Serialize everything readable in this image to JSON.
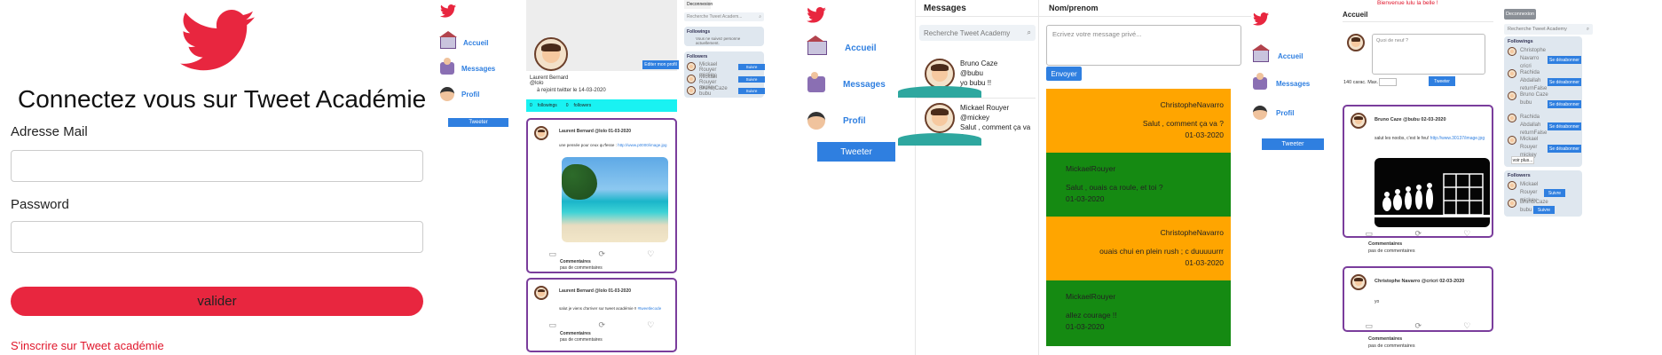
{
  "login": {
    "title": "Connectez vous sur Tweet Académie",
    "email_label": "Adresse Mail",
    "password_label": "Password",
    "submit_label": "valider",
    "signup_link": "S'inscrire sur Tweet académie",
    "brand_color": "#e8263f"
  },
  "profile_page": {
    "nav": {
      "home": "Accueil",
      "messages": "Messages",
      "profile": "Profil",
      "tweet_button": "Tweeter"
    },
    "user_name": "Laurent Bernard",
    "user_handle": "@lolo",
    "joined": "à rejoint twitter le 14-03-2020",
    "edit_button": "Editer mon profil",
    "followings_label": "followings",
    "followers_label": "followers",
    "followings_count": "0",
    "followers_count": "0",
    "logout_button": "Deconnexion",
    "search_placeholder": "Recherche Tweet Academ...",
    "followings_box": {
      "title": "Followings",
      "empty": "Vous ne suivez personne actuellement."
    },
    "followers_box": {
      "title": "Followers",
      "users": [
        {
          "name": "Mickael Rouyer",
          "handle": "mickey",
          "button": "Suivre"
        },
        {
          "name": "Mickael Rouyer",
          "handle": "mickey",
          "button": "Suivre"
        },
        {
          "name": "Bruno Caze",
          "handle": "bubu",
          "button": "Suivre"
        }
      ]
    },
    "tweets": [
      {
        "header": "Laurent Bernard @lolo 01-03-2020",
        "text": "une pensée pour ceux qu'fesse :",
        "link": "http://www.p0000/image.jpg",
        "comments_label": "Commentaires",
        "comments": "pas de commentaires"
      },
      {
        "header": "Laurent Bernard @lolo 01-03-2020",
        "text": "salut je viens d'arriver sur tweet académie !!",
        "link": "#tweetlecode",
        "comments_label": "Commentaires",
        "comments": "pas de commentaires"
      }
    ]
  },
  "messages_page": {
    "nav": {
      "home": "Accueil",
      "messages": "Messages",
      "profile": "Profil",
      "tweet_button": "Tweeter"
    },
    "column_title": "Messages",
    "conversation_title": "Nom/prenom",
    "search_placeholder": "Recherche Tweet Academy",
    "message_placeholder": "Ecrivez votre message privé...",
    "send_button": "Envoyer",
    "contacts": [
      {
        "name": "Bruno Caze",
        "handle": "@bubu",
        "preview": "yo bubu !!"
      },
      {
        "name": "Mickael Rouyer",
        "handle": "@mickey",
        "preview": "Salut , comment ça va ?"
      }
    ],
    "thread": [
      {
        "author": "ChristopheNavarro",
        "text": "Salut , comment ça va ?",
        "date": "01-03-2020",
        "side": "right",
        "color": "#ffa500"
      },
      {
        "author": "MickaelRouyer",
        "text": "Salut , ouais ca roule, et toi ?",
        "date": "01-03-2020",
        "side": "left",
        "color": "#158a12"
      },
      {
        "author": "ChristopheNavarro",
        "text": "ouais chui en plein rush ; c duuuuurrr",
        "date": "01-03-2020",
        "side": "right",
        "color": "#ffa500"
      },
      {
        "author": "MickaelRouyer",
        "text": "allez courage !!",
        "date": "01-03-2020",
        "side": "left",
        "color": "#158a12"
      }
    ]
  },
  "home_page": {
    "nav": {
      "home": "Accueil",
      "messages": "Messages",
      "profile": "Profil",
      "tweet_button": "Tweeter"
    },
    "welcome": "Bienvenue lulu la belle !",
    "title": "Accueil",
    "compose_placeholder": "Quoi de neuf ?",
    "char_counter": "140 carac. Max.",
    "tweet_button": "Tweeter",
    "logout_button": "Deconnexion",
    "search_placeholder": "Recherche Tweet Academy",
    "followings": {
      "title": "Followings",
      "users": [
        {
          "name": "Christophe Navarro",
          "handle": "cricri",
          "button": "Se désabonner"
        },
        {
          "name": "Rachida Abdallah",
          "handle": "returnFalse",
          "button": "Se désabonner"
        },
        {
          "name": "Bruno Caze",
          "handle": "bubu",
          "button": "Se désabonner"
        },
        {
          "name": "Rachida Abdallah",
          "handle": "returnFalse",
          "button": "Se désabonner"
        },
        {
          "name": "Mickael Rouyer",
          "handle": "mickey",
          "button": "Se désabonner"
        }
      ],
      "more": "voir plus..."
    },
    "followers": {
      "title": "Followers",
      "users": [
        {
          "name": "Mickael Rouyer",
          "handle": "mickey",
          "button": "Suivre"
        },
        {
          "name": "Bruno Caze",
          "handle": "bubu",
          "button": "Suivre"
        }
      ]
    },
    "tweets": [
      {
        "header": "Bruno Caze @bubu 02-03-2020",
        "text": "salut les noobs, c'est le feu!",
        "link": "http://www.30137/image.jpg",
        "comments_label": "Commentaires",
        "comments": "pas de commentaires"
      },
      {
        "header": "Christophe Navarro @cricri 02-03-2020",
        "text": "yo",
        "comments_label": "Commentaires",
        "comments": "pas de commentaires"
      }
    ]
  }
}
